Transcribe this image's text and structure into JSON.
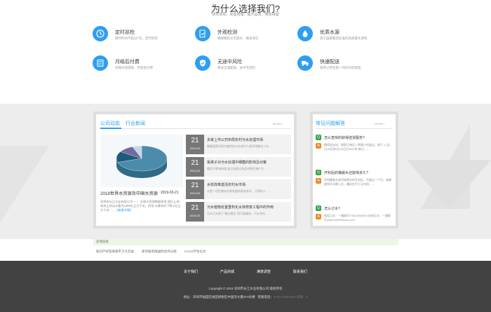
{
  "why": {
    "title": "为什么选择我们?",
    "subtitle": "\"讲究实现、完善管理、提升品质、用信得益\"",
    "features": [
      {
        "icon": "clock-icon",
        "title": "定时巡检",
        "desc": "随时时间不超过7天，定时巡检"
      },
      {
        "icon": "doc-check-icon",
        "title": "外观检测",
        "desc": "确保桶装水无漏水、桶身清洁"
      },
      {
        "icon": "water-drop-icon",
        "title": "优质水源",
        "desc": "高于国家最后标准的高质量水源地"
      },
      {
        "icon": "calculator-icon",
        "title": "月结后付费",
        "desc": "先喝水后结账，月结后付费"
      },
      {
        "icon": "shield-check-icon",
        "title": "无途中风险",
        "desc": "保证全城配送，途中无风险"
      },
      {
        "icon": "truck-icon",
        "title": "快速配送",
        "desc": "接到订单后第一时间为您配送"
      }
    ]
  },
  "news": {
    "tab_company": "公司动态",
    "tab_industry": "行业新闻",
    "more": "MORE+",
    "featured": {
      "title": "2018世界水资源及中国水资源",
      "date": "2019-03-21",
      "text": "深圳市长江水业有限公司 一… 全球水资源数据表地 理位上讲：地球上的淡水量为1399亿立方千米，所地 水量有所下降 5亿立方千米……",
      "more": "【查看详情】"
    },
    "items": [
      {
        "day": "21",
        "ym": "2019-03",
        "title": "多家上市公司布局农村污水处理市场",
        "desc": "随着国家环保力度的加大在农村人居环境整治三年……"
      },
      {
        "day": "21",
        "ym": "2019-03",
        "title": "氯离子对污水处理中细菌的影响及对策",
        "desc": "氯离子影响机理 盐分浓度过高会对微生物产生……"
      },
      {
        "day": "21",
        "ym": "2019-03",
        "title": "水权改革激活农村水市场",
        "desc": "水是一切生物存在和发展的基本条件，正常的人……"
      },
      {
        "day": "21",
        "ym": "2019-03",
        "title": "污水植物处置重构化水体修复工程中的作用",
        "desc": "污水污水经了\"植水植生\"而污染最终，污水净化……"
      }
    ]
  },
  "faq": {
    "title": "常见问题解答",
    "more": "MORE+",
    "items": [
      {
        "q": "怎么查快的获得送货服务?",
        "a": "期间送水时，接到订单后一到两小时送达，周六 1 日1日18日到1日18日日15小时·每日……"
      },
      {
        "q": "开封后的桶装水还能喝多久?",
        "a": "饮用桶装水须尽快将水的开封后，不超过一个月，如果放到开水桶上后，最好在平十天内用……"
      },
      {
        "q": "怎么订水?",
        "a": "电话订水：一通拨打0755-0000000 在线订水：一通拨打www.0000000xxx.com"
      }
    ]
  },
  "friends": {
    "title": "友情链接",
    "links": [
      "知识产权贸易第平工大云站",
      "新华联有限国际合作分组",
      "CAUS学生论文"
    ]
  },
  "footer": {
    "nav": [
      "关于我们",
      "产品商城",
      "满意调查",
      "联系我们"
    ],
    "copyright": "Copyright © 2016 深圳市长江水业有限公司 版权所有",
    "address": "地址：深圳市福田区福田保税区中国深大厦4F3号楼",
    "phone_label": "客服电话：",
    "phone_value": "0755-00000000 邮箱：0"
  },
  "chart_data": {
    "type": "pie",
    "title": "",
    "categories": [
      "",
      "",
      "",
      ""
    ],
    "values": [
      70,
      14,
      10,
      6
    ],
    "colors": [
      "#4a8caa",
      "#1e5a7a",
      "#6f6aa0",
      "#c9d6e4"
    ]
  }
}
